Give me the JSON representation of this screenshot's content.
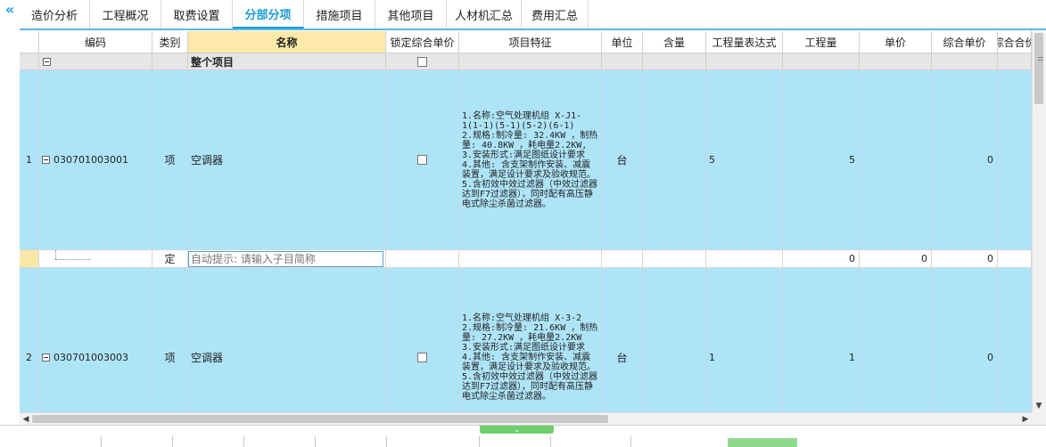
{
  "tabs": [
    {
      "label": "造价分析",
      "width": 79
    },
    {
      "label": "工程概况",
      "width": 80
    },
    {
      "label": "取费设置",
      "width": 80
    },
    {
      "label": "分部分项",
      "width": 80,
      "active": true
    },
    {
      "label": "措施项目",
      "width": 80
    },
    {
      "label": "其他项目",
      "width": 80
    },
    {
      "label": "人材机汇总",
      "width": 84
    },
    {
      "label": "费用汇总",
      "width": 75
    }
  ],
  "columns": [
    "",
    "编码",
    "类别",
    "名称",
    "锁定综合单价",
    "项目特征",
    "单位",
    "含量",
    "工程量表达式",
    "工程量",
    "单价",
    "综合单价",
    "综合合价"
  ],
  "group_row": {
    "name": "整个项目"
  },
  "rows": [
    {
      "index": "1",
      "code": "030701003001",
      "type": "项",
      "name": "空调器",
      "feature": "1.名称:空气处理机组 X-J1-1(1-1)(5-1)(5-2)(6-1)\n2.规格:制冷量: 32.4KW ，制热量: 40.8KW ，耗电量2.2KW,\n3.安装形式:满足图纸设计要求\n4.其他: 含支架制作安装、减震装置，满足设计要求及验收规范。\n5.含初效中效过滤器（中效过滤器达到F7过滤器），同时配有高压静电式除尘杀菌过滤器。",
      "unit": "台",
      "expr": "5",
      "qty": "5",
      "unit_price": "",
      "comp_price": "0"
    },
    {
      "index": "2",
      "code": "030701003003",
      "type": "项",
      "name": "空调器",
      "feature": "1.名称:空气处理机组 X-3-2\n2.规格:制冷量: 21.6KW ，制热量: 27.2KW ，耗电量2.2KW\n3.安装形式:满足图纸设计要求\n4.其他: 含支架制作安装、减震装置，满足设计要求及验收规范。\n5.含初效中效过滤器（中效过滤器达到F7过滤器），同时配有高压静电式除尘杀菌过滤器。",
      "unit": "台",
      "expr": "1",
      "qty": "1",
      "unit_price": "",
      "comp_price": "0"
    }
  ],
  "sub_row": {
    "type": "定",
    "placeholder": "自动提示: 请输入子目简称",
    "qty": "0",
    "unit_price": "0",
    "comp_price": "0"
  }
}
